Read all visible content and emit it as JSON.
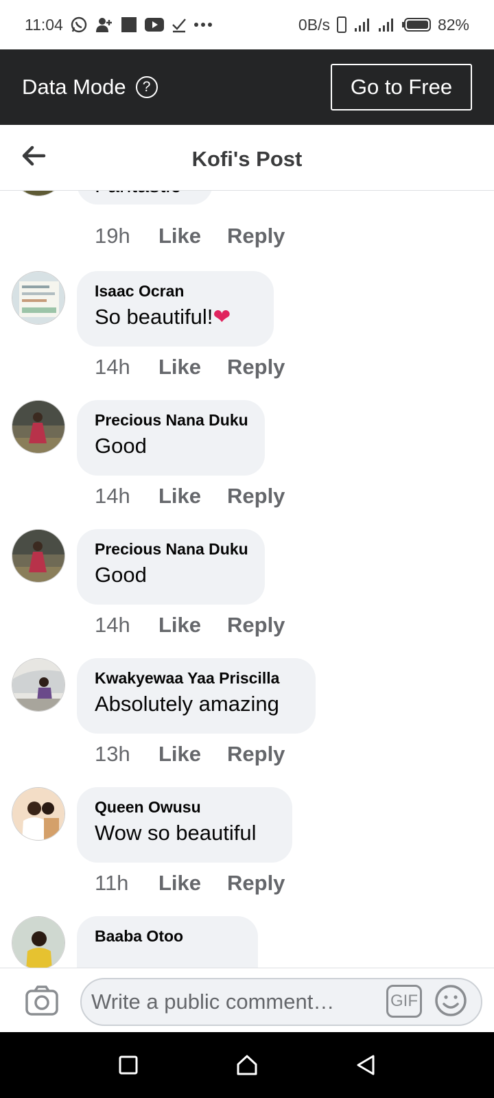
{
  "status_bar": {
    "time": "11:04",
    "net_speed": "0B/s",
    "battery": "82%",
    "icons": [
      "whatsapp-icon",
      "add-user-icon",
      "square-icon",
      "youtube-icon",
      "check-icon",
      "more-icon",
      "phone-icon",
      "signal-icon",
      "signal-icon",
      "battery-icon"
    ]
  },
  "data_mode": {
    "title": "Data Mode",
    "help_icon": "?",
    "go_free_label": "Go to Free"
  },
  "header": {
    "title": "Kofi's Post",
    "back_icon": "arrow-left-icon"
  },
  "comments": [
    {
      "author": "",
      "text": "Fantastic",
      "time": "19h",
      "like": "Like",
      "reply": "Reply"
    },
    {
      "author": "Isaac Ocran",
      "text": "So beautiful!",
      "emoji": "❤",
      "time": "14h",
      "like": "Like",
      "reply": "Reply"
    },
    {
      "author": "Precious Nana Duku",
      "text": "Good",
      "time": "14h",
      "like": "Like",
      "reply": "Reply"
    },
    {
      "author": "Precious Nana Duku",
      "text": "Good",
      "time": "14h",
      "like": "Like",
      "reply": "Reply"
    },
    {
      "author": "Kwakyewaa Yaa Priscilla",
      "text": "Absolutely amazing",
      "time": "13h",
      "like": "Like",
      "reply": "Reply"
    },
    {
      "author": "Queen Owusu",
      "text": "Wow so beautiful",
      "time": "11h",
      "like": "Like",
      "reply": "Reply"
    },
    {
      "author": "Baaba Otoo",
      "text": "",
      "time": "",
      "like": "",
      "reply": ""
    }
  ],
  "composer": {
    "placeholder": "Write a public comment…",
    "gif_label": "GIF"
  },
  "colors": {
    "data_bar_bg": "#242526",
    "bubble_bg": "#f0f2f5",
    "secondary_text": "#65676b",
    "heart": "#e0245e"
  }
}
